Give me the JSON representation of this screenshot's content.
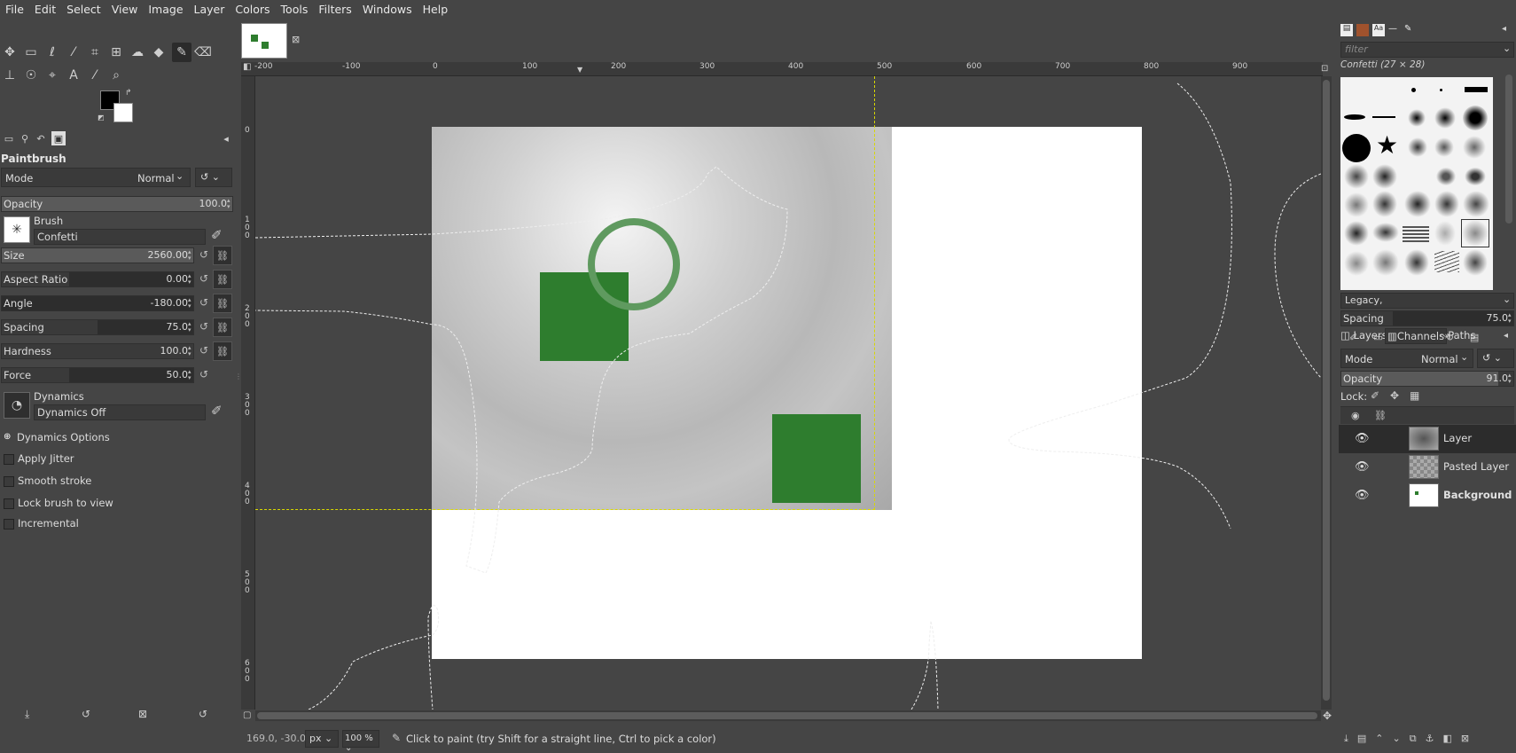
{
  "menubar": [
    "File",
    "Edit",
    "Select",
    "View",
    "Image",
    "Layer",
    "Colors",
    "Tools",
    "Filters",
    "Windows",
    "Help"
  ],
  "tool_options": {
    "title": "Paintbrush",
    "mode_label": "Mode",
    "mode_value": "Normal",
    "opacity": {
      "label": "Opacity",
      "value": "100.0",
      "fraction": 1.0
    },
    "brush_label": "Brush",
    "brush_name": "Confetti",
    "size": {
      "label": "Size",
      "value": "2560.00",
      "fraction": 1.0
    },
    "aspect": {
      "label": "Aspect Ratio",
      "value": "0.00",
      "fraction": 0.35
    },
    "angle": {
      "label": "Angle",
      "value": "-180.00",
      "fraction": 0.0
    },
    "spacing": {
      "label": "Spacing",
      "value": "75.0",
      "fraction": 0.4
    },
    "hardness": {
      "label": "Hardness",
      "value": "100.0",
      "fraction": 1.0
    },
    "force": {
      "label": "Force",
      "value": "50.0",
      "fraction": 0.35
    },
    "dynamics_label": "Dynamics",
    "dynamics_value": "Dynamics Off",
    "dynamics_options": "Dynamics Options",
    "apply_jitter": "Apply Jitter",
    "smooth_stroke": "Smooth stroke",
    "lock_brush": "Lock brush to view",
    "incremental": "Incremental"
  },
  "ruler": {
    "top_ticks": [
      "-200",
      "-100",
      "0",
      "100",
      "200",
      "300",
      "400",
      "500",
      "600",
      "700",
      "800",
      "900"
    ],
    "left_ticks": [
      "0",
      "100",
      "200",
      "300",
      "400",
      "500",
      "600"
    ]
  },
  "status": {
    "coords": "169.0, -30.0",
    "unit": "px",
    "zoom": "100 %",
    "message": "Click to paint (try Shift for a straight line, Ctrl to pick a color)"
  },
  "brushes": {
    "filter_placeholder": "filter",
    "current": "Confetti (27 × 28)",
    "tag": "Legacy,",
    "spacing_label": "Spacing",
    "spacing_value": "75.0"
  },
  "layers_panel": {
    "tabs": [
      "Layers",
      "Channels",
      "Paths"
    ],
    "mode_label": "Mode",
    "mode_value": "Normal",
    "opacity_label": "Opacity",
    "opacity_value": "91.0",
    "lock_label": "Lock:",
    "layers": [
      {
        "name": "Layer",
        "bold": false
      },
      {
        "name": "Pasted Layer",
        "bold": false
      },
      {
        "name": "Background",
        "bold": true
      }
    ]
  },
  "colors": {
    "fg": "#000000",
    "bg": "#ffffff",
    "green": "#2e7d2e"
  }
}
